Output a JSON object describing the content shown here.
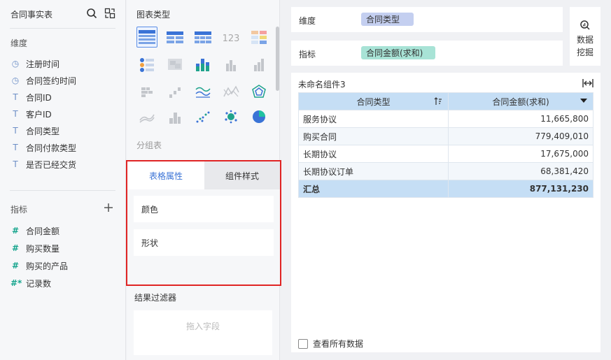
{
  "left_panel": {
    "title": "合同事实表",
    "dimensions_label": "维度",
    "dimensions": [
      {
        "icon": "clock-icon",
        "label": "注册时间"
      },
      {
        "icon": "clock-icon",
        "label": "合同签约时间"
      },
      {
        "icon": "text-type-icon",
        "label": "合同ID"
      },
      {
        "icon": "text-type-icon",
        "label": "客户ID"
      },
      {
        "icon": "text-type-icon",
        "label": "合同类型"
      },
      {
        "icon": "text-type-icon",
        "label": "合同付款类型"
      },
      {
        "icon": "text-type-icon",
        "label": "是否已经交货"
      }
    ],
    "measures_label": "指标",
    "measures": [
      {
        "icon": "hash-icon",
        "label": "合同金额"
      },
      {
        "icon": "hash-icon",
        "label": "购买数量"
      },
      {
        "icon": "hash-icon",
        "label": "购买的产品"
      },
      {
        "icon": "hash-star-icon",
        "label": "记录数"
      }
    ]
  },
  "middle_panel": {
    "chart_type_title": "图表类型",
    "chart_types": [
      "table-grouped-icon",
      "table-cross-icon",
      "table-detail-icon",
      "kpi-number-icon",
      "table-colored-icon",
      "map-points-icon",
      "heatmap-icon",
      "bar-stacked-icon",
      "bar-grouped-icon",
      "bar-percent-icon",
      "bar-horizontal-icon",
      "waterfall-icon",
      "line-icon",
      "radar-line-icon",
      "radar-icon",
      "area-icon",
      "histogram-icon",
      "scatter-icon",
      "bubble-icon",
      "pie-icon"
    ],
    "selected_chart_index": 0,
    "group_table_label": "分组表",
    "tabs": [
      "表格属性",
      "组件样式"
    ],
    "active_tab": 0,
    "props": [
      "颜色",
      "形状"
    ],
    "filter_label": "结果过滤器",
    "drop_placeholder": "拖入字段"
  },
  "config": {
    "dimension_label": "维度",
    "dimension_pill": "合同类型",
    "measure_label": "指标",
    "measure_pill": "合同金额(求和)",
    "mining_label_1": "数据",
    "mining_label_2": "挖掘"
  },
  "widget": {
    "title": "未命名组件3",
    "columns": [
      "合同类型",
      "合同金额(求和)"
    ],
    "rows": [
      [
        "服务协议",
        "11,665,800"
      ],
      [
        "购买合同",
        "779,409,010"
      ],
      [
        "长期协议",
        "17,675,000"
      ],
      [
        "长期协议订单",
        "68,381,420"
      ]
    ],
    "total": [
      "汇总",
      "877,131,230"
    ],
    "view_all_label": "查看所有数据"
  },
  "colors": {
    "accent": "#3a73d6",
    "highlight_border": "#e02424",
    "dimension_pill": "#c4cff0",
    "measure_pill": "#a8e3d6",
    "table_header": "#c5def5"
  }
}
